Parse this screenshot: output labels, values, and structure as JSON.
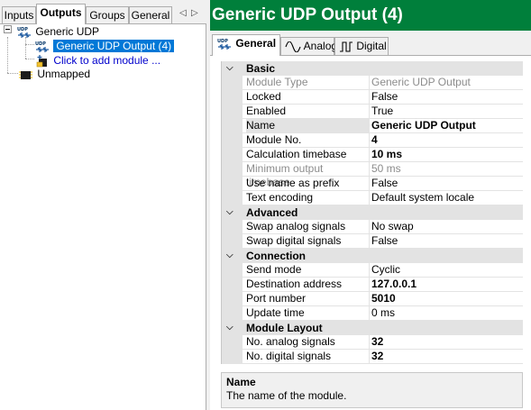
{
  "left_tabs": [
    "Inputs",
    "Outputs",
    "Groups",
    "General"
  ],
  "tree": {
    "root": "Generic UDP",
    "selected_module": "Generic UDP Output (4)",
    "add_module": "Click to add module ...",
    "unmapped": "Unmapped"
  },
  "header": {
    "title": "Generic UDP Output (4)",
    "color": "#007f3b"
  },
  "right_tabs": [
    "General",
    "Analog",
    "Digital"
  ],
  "icons": {
    "udp": "udp-icon",
    "analog": "sine-wave-icon",
    "digital": "square-wave-icon"
  },
  "categories": [
    {
      "label": "Basic",
      "props": [
        {
          "name": "Module Type",
          "value": "Generic UDP Output",
          "disabled": true
        },
        {
          "name": "Locked",
          "value": "False"
        },
        {
          "name": "Enabled",
          "value": "True"
        },
        {
          "name": "Name",
          "value": "Generic UDP Output",
          "bold": true,
          "selected": true
        },
        {
          "name": "Module No.",
          "value": "4",
          "bold": true
        },
        {
          "name": "Calculation timebase",
          "value": "10 ms",
          "bold": true
        },
        {
          "name": "Minimum output timebase",
          "value": "50 ms",
          "disabled": true
        },
        {
          "name": "Use name as prefix",
          "value": "False"
        },
        {
          "name": "Text encoding",
          "value": "Default system locale"
        }
      ]
    },
    {
      "label": "Advanced",
      "props": [
        {
          "name": "Swap analog signals",
          "value": "No swap"
        },
        {
          "name": "Swap digital signals",
          "value": "False"
        }
      ]
    },
    {
      "label": "Connection",
      "props": [
        {
          "name": "Send mode",
          "value": "Cyclic"
        },
        {
          "name": "Destination address",
          "value": "127.0.0.1",
          "bold": true
        },
        {
          "name": "Port number",
          "value": "5010",
          "bold": true
        },
        {
          "name": "Update time",
          "value": "0 ms"
        }
      ]
    },
    {
      "label": "Module Layout",
      "props": [
        {
          "name": "No. analog signals",
          "value": "32",
          "bold": true
        },
        {
          "name": "No. digital signals",
          "value": "32",
          "bold": true
        }
      ]
    }
  ],
  "description": {
    "title": "Name",
    "text": "The name of the module."
  }
}
